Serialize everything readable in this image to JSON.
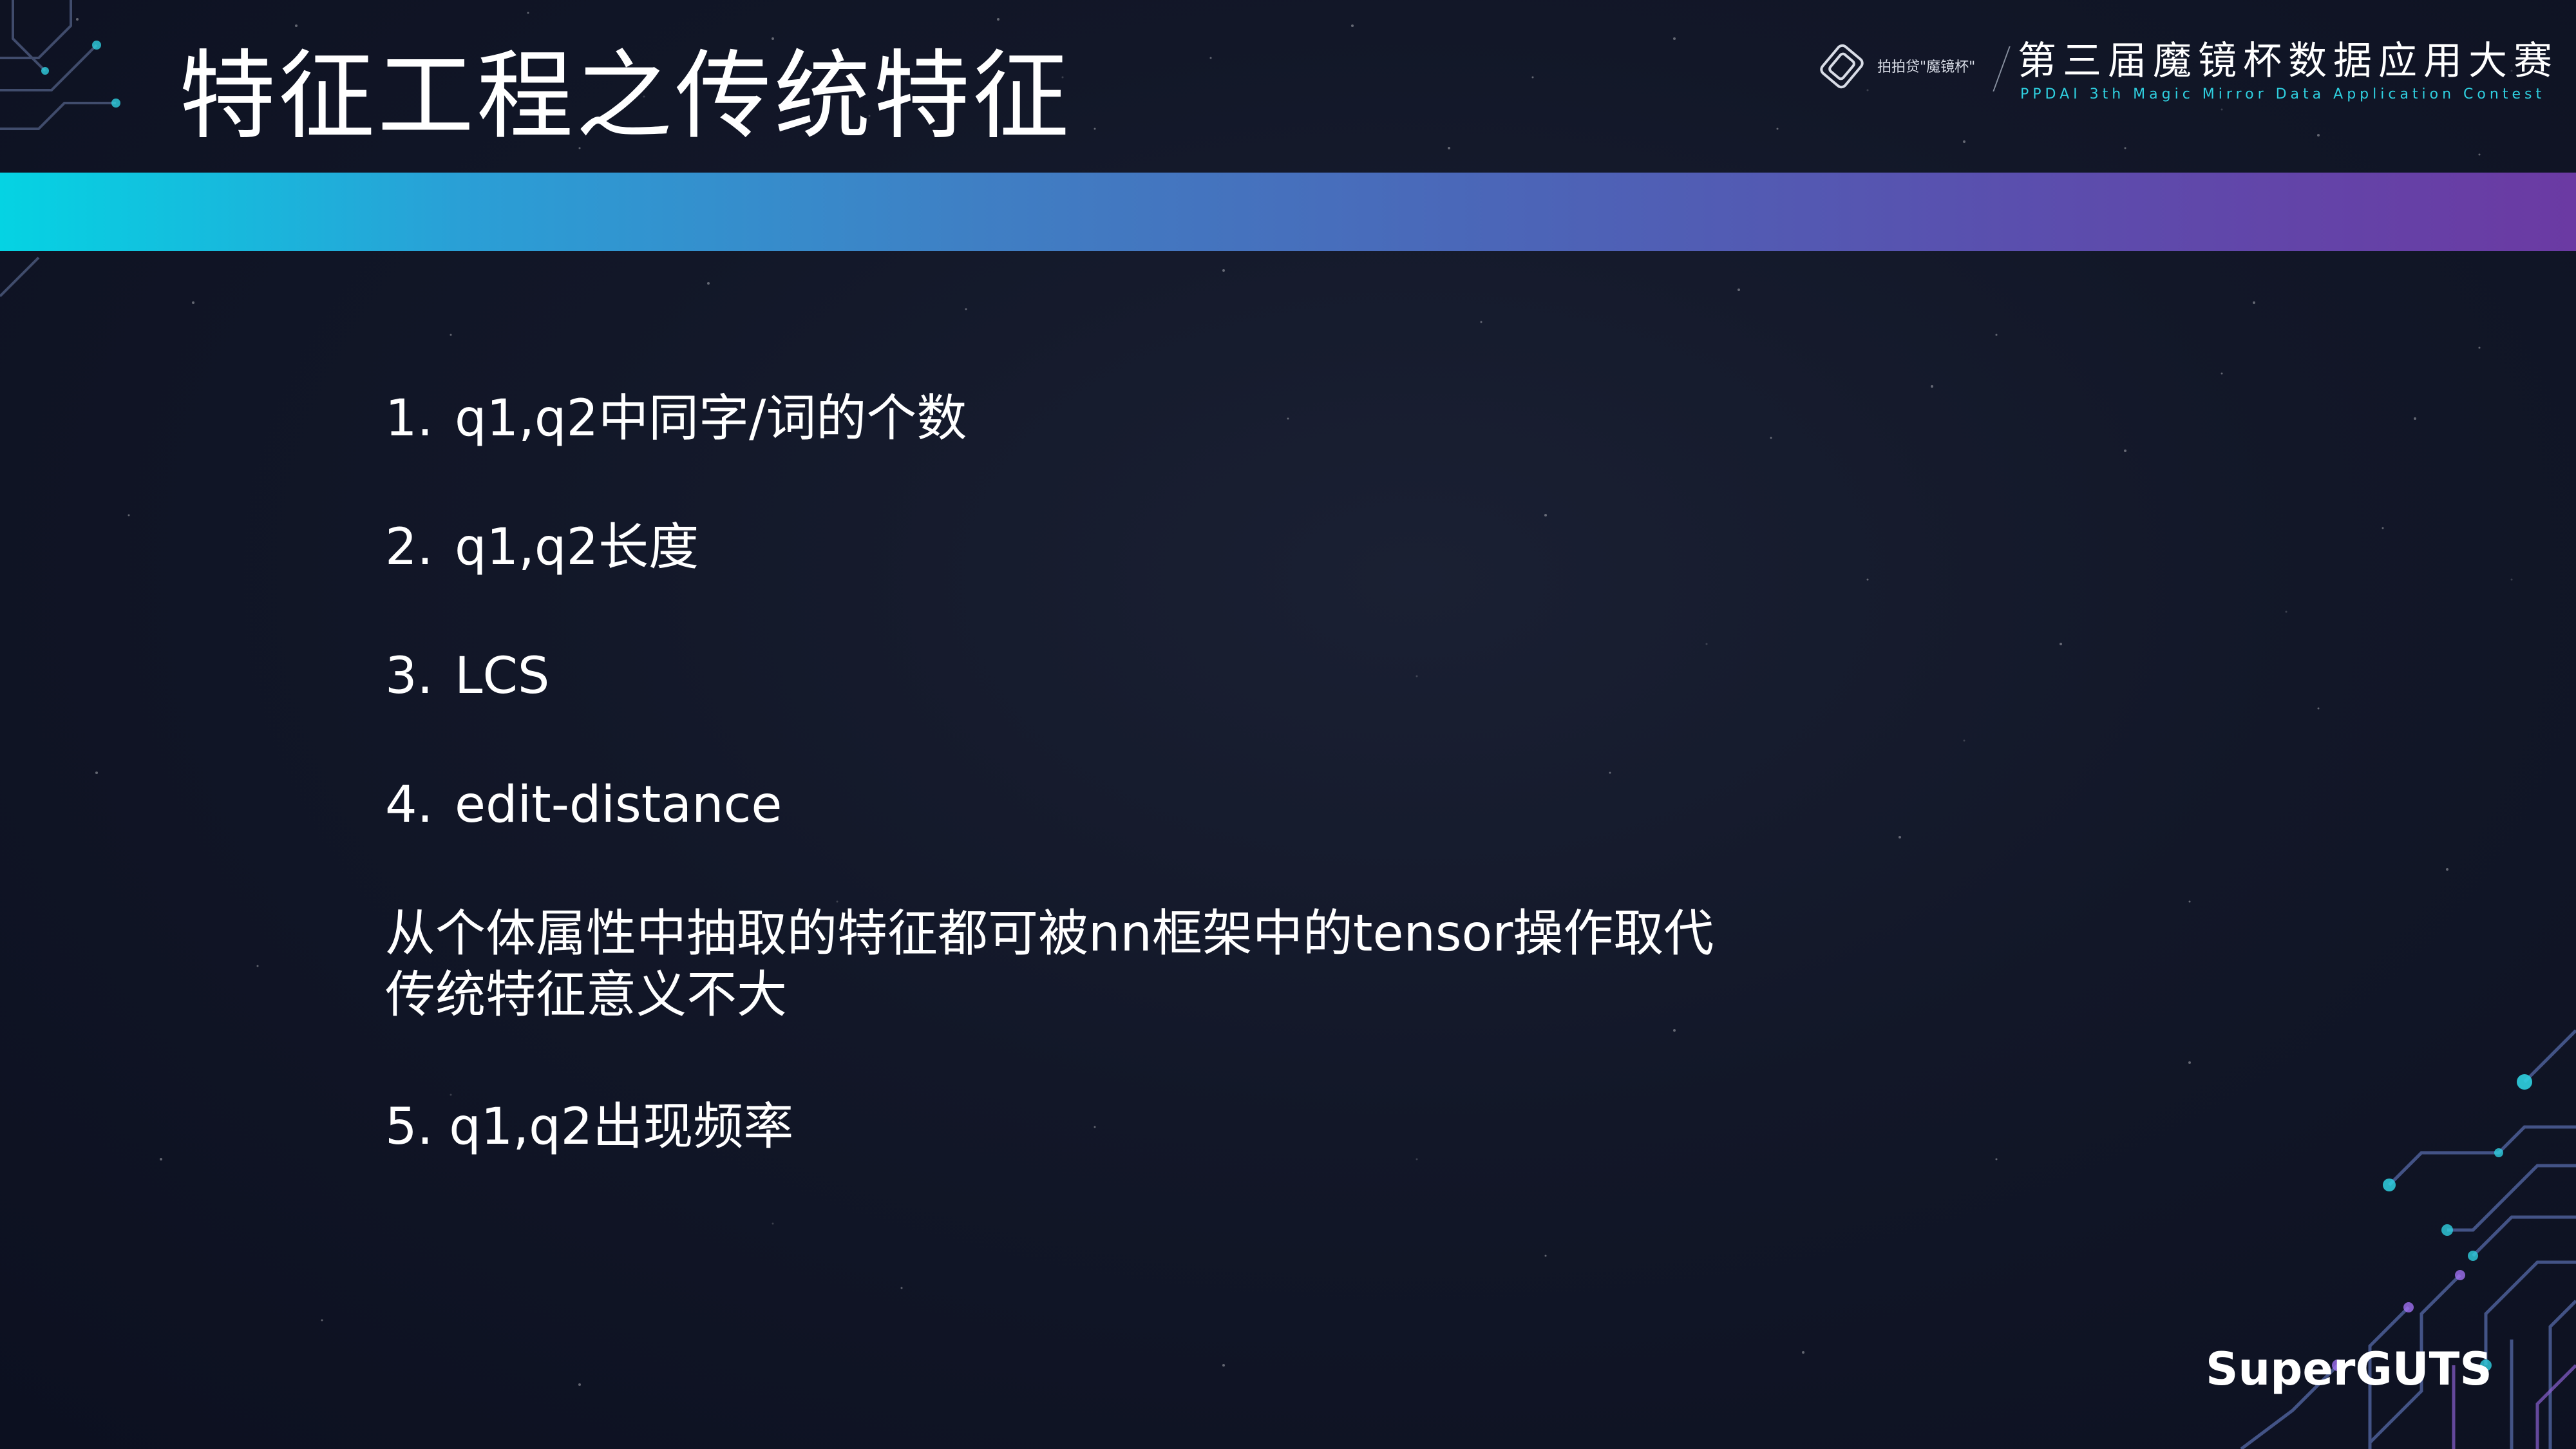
{
  "slide": {
    "title": "特征工程之传统特征"
  },
  "brand": {
    "logo_text": "拍拍贷\"魔镜杯\"",
    "title": "第三届魔镜杯数据应用大赛",
    "subtitle": "PPDAI 3th Magic Mirror Data Application Contest"
  },
  "content": {
    "items": [
      {
        "num": "1.",
        "text": "q1,q2中同字/词的个数"
      },
      {
        "num": "2.",
        "text": "q1,q2长度"
      },
      {
        "num": "3.",
        "text": "LCS"
      },
      {
        "num": "4.",
        "text": "edit-distance"
      }
    ],
    "note_line1": "从个体属性中抽取的特征都可被nn框架中的tensor操作取代",
    "note_line2": "传统特征意义不大",
    "item5": "5. q1,q2出现频率"
  },
  "watermark": "SuperGUTS",
  "colors": {
    "background": "#121728",
    "bar_start": "#05d3e3",
    "bar_end": "#6b3aa3",
    "brand_subtitle": "#2fd0e0",
    "text": "#ffffff"
  },
  "icons": {
    "brand_logo": "mirror-logo-icon",
    "circuit_top_left": "circuit-decoration-icon",
    "circuit_bottom_right": "circuit-decoration-icon"
  }
}
